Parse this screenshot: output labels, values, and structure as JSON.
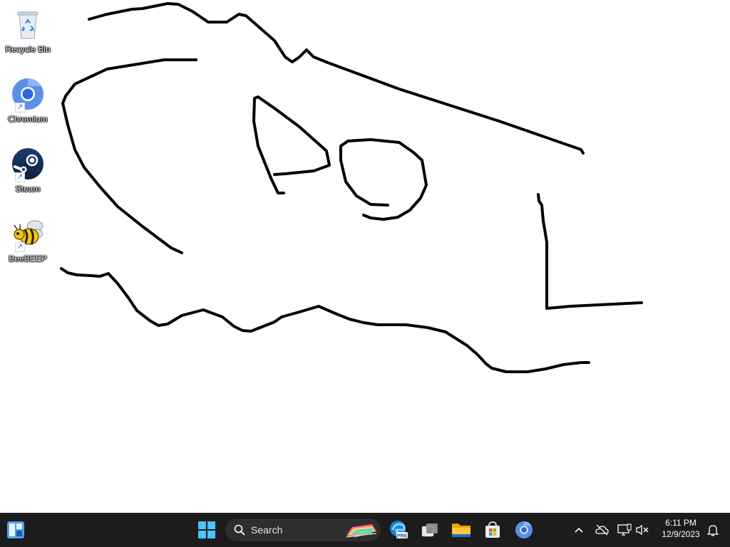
{
  "desktop": {
    "icons": [
      {
        "label": "Recycle Bin",
        "icon": "recycle-bin-icon",
        "shortcut": false
      },
      {
        "label": "Chromium",
        "icon": "chromium-icon",
        "shortcut": true
      },
      {
        "label": "Steam",
        "icon": "steam-icon",
        "shortcut": true
      },
      {
        "label": "BeeBEEP",
        "icon": "beebeep-icon",
        "shortcut": true
      }
    ],
    "shortcut_arrow": "↗",
    "drawing_color": "#000000",
    "background_color": "#ffffff"
  },
  "taskbar": {
    "background_color": "#1c1c1c",
    "search": {
      "placeholder": "Search"
    },
    "pinned": [
      {
        "name": "widgets",
        "icon": "widgets-icon"
      },
      {
        "name": "start",
        "icon": "windows-logo-icon"
      },
      {
        "name": "edge-beta",
        "icon": "edge-beta-icon",
        "badge": "PRE"
      },
      {
        "name": "task-view",
        "icon": "task-view-icon"
      },
      {
        "name": "file-explorer",
        "icon": "folder-icon"
      },
      {
        "name": "microsoft-store",
        "icon": "store-icon"
      },
      {
        "name": "chromium",
        "icon": "chromium-icon"
      }
    ],
    "tray": {
      "icons": [
        "chevron-up-icon",
        "network-offline-icon",
        "display-icon",
        "volume-muted-icon",
        "notification-bell-icon"
      ],
      "time": "6:11 PM",
      "date": "12/9/2023"
    }
  }
}
